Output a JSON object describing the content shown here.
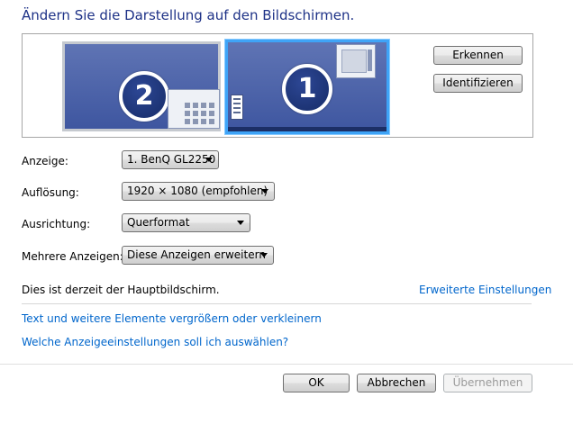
{
  "title": "Ändern Sie die Darstellung auf den Bildschirmen.",
  "preview": {
    "monitors": [
      {
        "number": "2",
        "selected": false
      },
      {
        "number": "1",
        "selected": true
      }
    ],
    "detect_label": "Erkennen",
    "identify_label": "Identifizieren"
  },
  "settings": {
    "display": {
      "label": "Anzeige:",
      "value": "1. BenQ GL2250"
    },
    "resolution": {
      "label": "Auflösung:",
      "value": "1920 × 1080 (empfohlen)"
    },
    "orientation": {
      "label": "Ausrichtung:",
      "value": "Querformat"
    },
    "multiple": {
      "label": "Mehrere Anzeigen:",
      "value": "Diese Anzeigen erweitern"
    }
  },
  "status_text": "Dies ist derzeit der Hauptbildschirm.",
  "advanced_link": "Erweiterte Einstellungen",
  "links": {
    "text_size": "Text und weitere Elemente vergrößern oder verkleinern",
    "which_settings": "Welche Anzeigeeinstellungen soll ich auswählen?"
  },
  "footer": {
    "ok": "OK",
    "cancel": "Abbrechen",
    "apply": "Übernehmen"
  },
  "colors": {
    "title": "#1e3287",
    "link": "#0066cc",
    "selected_monitor_border": "#3fa4f7"
  }
}
